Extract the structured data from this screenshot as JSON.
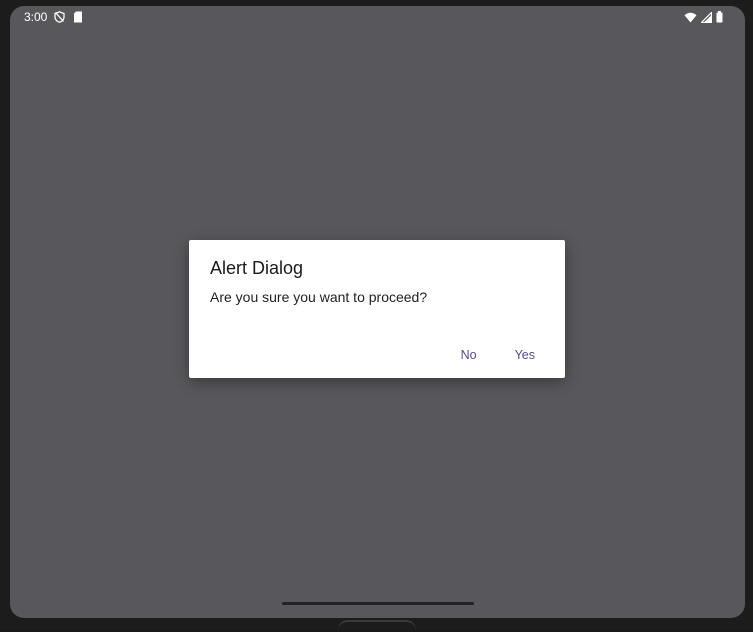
{
  "status_bar": {
    "time": "3:00",
    "left_icons": [
      "shield-off-icon",
      "sd-card-icon"
    ],
    "right_icons": [
      "wifi-icon",
      "cell-signal-icon",
      "battery-icon"
    ]
  },
  "dialog": {
    "title": "Alert Dialog",
    "message": "Are you sure you want to proceed?",
    "buttons": {
      "no": "No",
      "yes": "Yes"
    }
  },
  "colors": {
    "scrim": "#58575b",
    "dialog_bg": "#ffffff",
    "button_text": "#5b4a8f"
  }
}
